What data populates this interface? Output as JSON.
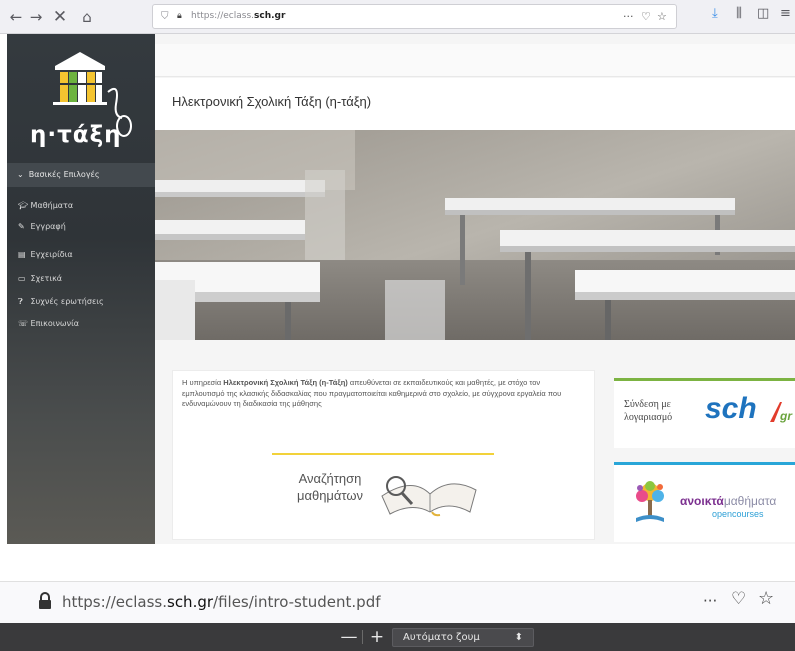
{
  "browser_top": {
    "url_prefix": "https://eclass.",
    "url_domain": "sch.gr",
    "page_actions": "···"
  },
  "sidebar": {
    "logo_text": "η·τάξη",
    "menu_header": "Βασικές Επιλογές",
    "items": [
      {
        "label": "Μαθήματα",
        "icon": "graduation-cap-icon"
      },
      {
        "label": "Εγγραφή",
        "icon": "edit-icon"
      },
      {
        "label": "Εγχειρίδια",
        "icon": "file-icon"
      },
      {
        "label": "Σχετικά",
        "icon": "credit-card-icon"
      },
      {
        "label": "Συχνές ερωτήσεις",
        "icon": "question-circle-icon"
      },
      {
        "label": "Επικοινωνία",
        "icon": "phone-icon"
      }
    ]
  },
  "main": {
    "title": "Ηλεκτρονική Σχολική Τάξη (η-τάξη)",
    "intro_pre": "Η υπηρεσία ",
    "intro_bold": "Ηλεκτρονική Σχολική Τάξη (η-Τάξη)",
    "intro_post": " απευθύνεται σε εκπαιδευτικούς και μαθητές, με στόχο τον εμπλουτισμό της κλασικής διδασκαλίας που πραγματοποιείται καθημερινά στο σχολείο, με σύγχρονα εργαλεία που ενδυναμώνουν τη διαδικασία της μάθησης",
    "search_line1": "Αναζήτηση",
    "search_line2": "μαθημάτων",
    "login_line1": "Σύνδεση με",
    "login_line2": "λογαριασμό",
    "sch_logo": "sch",
    "sch_gr": "gr",
    "oc_bold": "ανοικτά",
    "oc_light": "μαθήματα",
    "oc_sub": "opencourses"
  },
  "browser_bottom": {
    "url_prefix": "https://eclass.",
    "url_domain": "sch.gr",
    "url_suffix": "/files/intro-student.pdf",
    "page_actions": "···",
    "zoom_label": "Αυτόματο ζουμ",
    "zoom_out": "—",
    "zoom_in": "+"
  },
  "colors": {
    "accent_green": "#7cb342",
    "accent_blue": "#29a6d8",
    "accent_yellow": "#f2d23a",
    "sch_blue": "#1e73be",
    "sidebar_bg": "#343a3f"
  }
}
